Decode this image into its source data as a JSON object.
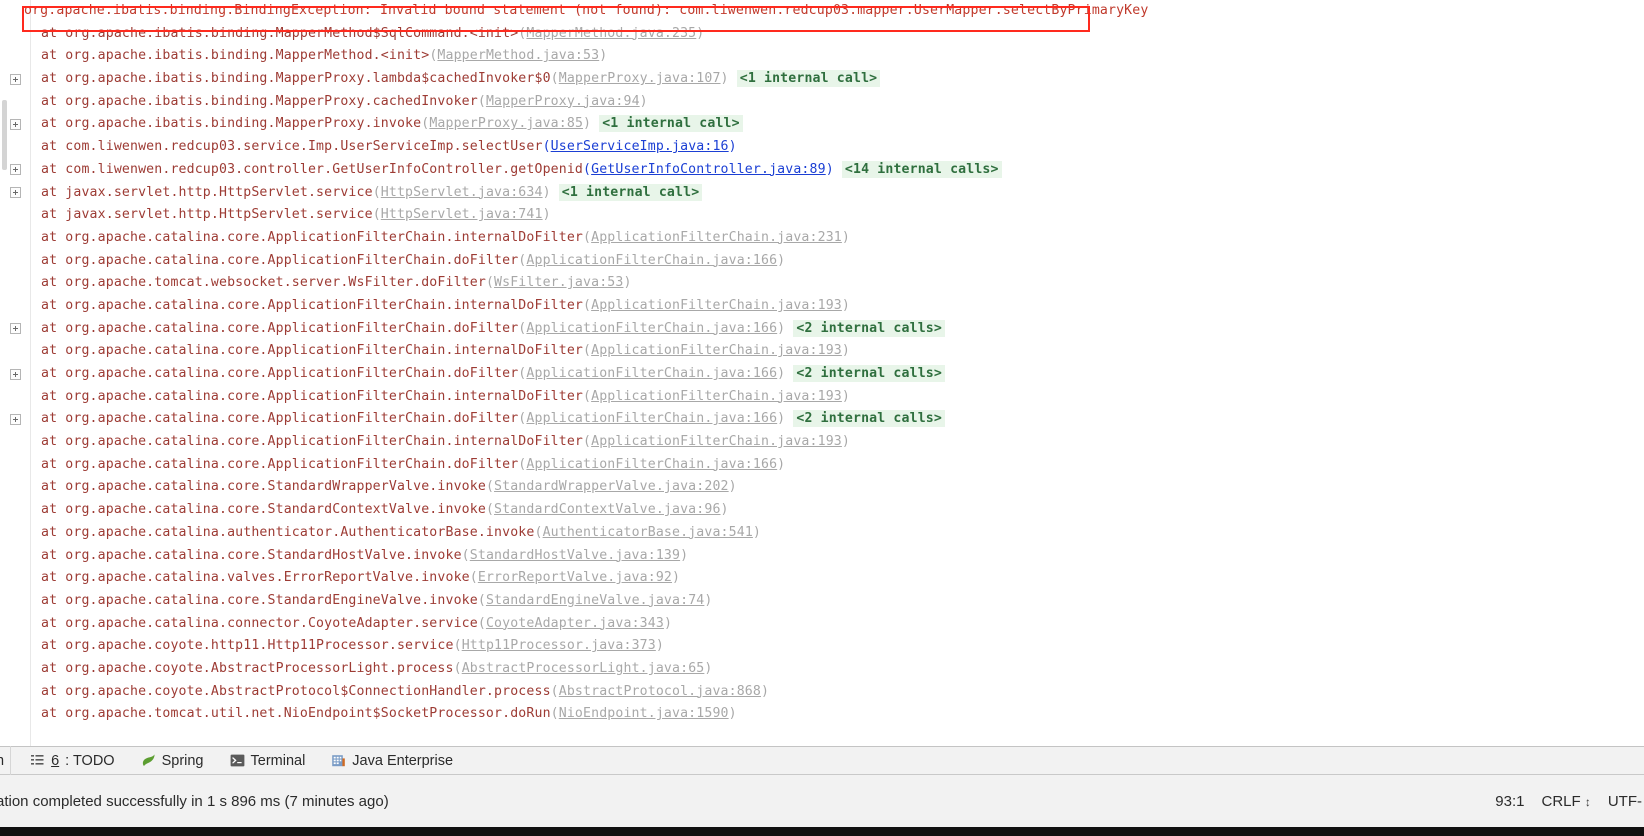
{
  "console": {
    "exception_header": "org.apache.ibatis.binding.BindingException: Invalid bound statement (not found): com.liwenwen.redcup03.mapper.UserMapper.selectByPrimaryKey",
    "frames": [
      {
        "fold": false,
        "at": "at ",
        "frame": "org.apache.ibatis.binding.MapperMethod$SqlCommand.<init>",
        "link": "MapperMethod.java:235",
        "link_type": "lib",
        "internal": ""
      },
      {
        "fold": false,
        "at": "at ",
        "frame": "org.apache.ibatis.binding.MapperMethod.<init>",
        "link": "MapperMethod.java:53",
        "link_type": "lib",
        "internal": ""
      },
      {
        "fold": true,
        "at": "at ",
        "frame": "org.apache.ibatis.binding.MapperProxy.lambda$cachedInvoker$0",
        "link": "MapperProxy.java:107",
        "link_type": "lib",
        "internal": "<1 internal call>"
      },
      {
        "fold": false,
        "at": "at ",
        "frame": "org.apache.ibatis.binding.MapperProxy.cachedInvoker",
        "link": "MapperProxy.java:94",
        "link_type": "lib",
        "internal": ""
      },
      {
        "fold": true,
        "at": "at ",
        "frame": "org.apache.ibatis.binding.MapperProxy.invoke",
        "link": "MapperProxy.java:85",
        "link_type": "lib",
        "internal": "<1 internal call>"
      },
      {
        "fold": false,
        "at": "at ",
        "frame": "com.liwenwen.redcup03.service.Imp.UserServiceImp.selectUser",
        "link": "UserServiceImp.java:16",
        "link_type": "user",
        "internal": ""
      },
      {
        "fold": true,
        "at": "at ",
        "frame": "com.liwenwen.redcup03.controller.GetUserInfoController.getOpenid",
        "link": "GetUserInfoController.java:89",
        "link_type": "user",
        "internal": "<14 internal calls>"
      },
      {
        "fold": true,
        "at": "at ",
        "frame": "javax.servlet.http.HttpServlet.service",
        "link": "HttpServlet.java:634",
        "link_type": "lib",
        "internal": "<1 internal call>"
      },
      {
        "fold": false,
        "at": "at ",
        "frame": "javax.servlet.http.HttpServlet.service",
        "link": "HttpServlet.java:741",
        "link_type": "lib",
        "internal": ""
      },
      {
        "fold": false,
        "at": "at ",
        "frame": "org.apache.catalina.core.ApplicationFilterChain.internalDoFilter",
        "link": "ApplicationFilterChain.java:231",
        "link_type": "lib",
        "internal": ""
      },
      {
        "fold": false,
        "at": "at ",
        "frame": "org.apache.catalina.core.ApplicationFilterChain.doFilter",
        "link": "ApplicationFilterChain.java:166",
        "link_type": "lib",
        "internal": ""
      },
      {
        "fold": false,
        "at": "at ",
        "frame": "org.apache.tomcat.websocket.server.WsFilter.doFilter",
        "link": "WsFilter.java:53",
        "link_type": "lib",
        "internal": ""
      },
      {
        "fold": false,
        "at": "at ",
        "frame": "org.apache.catalina.core.ApplicationFilterChain.internalDoFilter",
        "link": "ApplicationFilterChain.java:193",
        "link_type": "lib",
        "internal": ""
      },
      {
        "fold": true,
        "at": "at ",
        "frame": "org.apache.catalina.core.ApplicationFilterChain.doFilter",
        "link": "ApplicationFilterChain.java:166",
        "link_type": "lib",
        "internal": "<2 internal calls>"
      },
      {
        "fold": false,
        "at": "at ",
        "frame": "org.apache.catalina.core.ApplicationFilterChain.internalDoFilter",
        "link": "ApplicationFilterChain.java:193",
        "link_type": "lib",
        "internal": ""
      },
      {
        "fold": true,
        "at": "at ",
        "frame": "org.apache.catalina.core.ApplicationFilterChain.doFilter",
        "link": "ApplicationFilterChain.java:166",
        "link_type": "lib",
        "internal": "<2 internal calls>"
      },
      {
        "fold": false,
        "at": "at ",
        "frame": "org.apache.catalina.core.ApplicationFilterChain.internalDoFilter",
        "link": "ApplicationFilterChain.java:193",
        "link_type": "lib",
        "internal": ""
      },
      {
        "fold": true,
        "at": "at ",
        "frame": "org.apache.catalina.core.ApplicationFilterChain.doFilter",
        "link": "ApplicationFilterChain.java:166",
        "link_type": "lib",
        "internal": "<2 internal calls>"
      },
      {
        "fold": false,
        "at": "at ",
        "frame": "org.apache.catalina.core.ApplicationFilterChain.internalDoFilter",
        "link": "ApplicationFilterChain.java:193",
        "link_type": "lib",
        "internal": ""
      },
      {
        "fold": false,
        "at": "at ",
        "frame": "org.apache.catalina.core.ApplicationFilterChain.doFilter",
        "link": "ApplicationFilterChain.java:166",
        "link_type": "lib",
        "internal": ""
      },
      {
        "fold": false,
        "at": "at ",
        "frame": "org.apache.catalina.core.StandardWrapperValve.invoke",
        "link": "StandardWrapperValve.java:202",
        "link_type": "lib",
        "internal": ""
      },
      {
        "fold": false,
        "at": "at ",
        "frame": "org.apache.catalina.core.StandardContextValve.invoke",
        "link": "StandardContextValve.java:96",
        "link_type": "lib",
        "internal": ""
      },
      {
        "fold": false,
        "at": "at ",
        "frame": "org.apache.catalina.authenticator.AuthenticatorBase.invoke",
        "link": "AuthenticatorBase.java:541",
        "link_type": "lib",
        "internal": ""
      },
      {
        "fold": false,
        "at": "at ",
        "frame": "org.apache.catalina.core.StandardHostValve.invoke",
        "link": "StandardHostValve.java:139",
        "link_type": "lib",
        "internal": ""
      },
      {
        "fold": false,
        "at": "at ",
        "frame": "org.apache.catalina.valves.ErrorReportValve.invoke",
        "link": "ErrorReportValve.java:92",
        "link_type": "lib",
        "internal": ""
      },
      {
        "fold": false,
        "at": "at ",
        "frame": "org.apache.catalina.core.StandardEngineValve.invoke",
        "link": "StandardEngineValve.java:74",
        "link_type": "lib",
        "internal": ""
      },
      {
        "fold": false,
        "at": "at ",
        "frame": "org.apache.catalina.connector.CoyoteAdapter.service",
        "link": "CoyoteAdapter.java:343",
        "link_type": "lib",
        "internal": ""
      },
      {
        "fold": false,
        "at": "at ",
        "frame": "org.apache.coyote.http11.Http11Processor.service",
        "link": "Http11Processor.java:373",
        "link_type": "lib",
        "internal": ""
      },
      {
        "fold": false,
        "at": "at ",
        "frame": "org.apache.coyote.AbstractProcessorLight.process",
        "link": "AbstractProcessorLight.java:65",
        "link_type": "lib",
        "internal": ""
      },
      {
        "fold": false,
        "at": "at ",
        "frame": "org.apache.coyote.AbstractProtocol$ConnectionHandler.process",
        "link": "AbstractProtocol.java:868",
        "link_type": "lib",
        "internal": ""
      },
      {
        "fold": false,
        "at": "at ",
        "frame": "org.apache.tomcat.util.net.NioEndpoint$SocketProcessor.doRun",
        "link": "NioEndpoint.java:1590",
        "link_type": "lib",
        "internal": ""
      }
    ]
  },
  "toolwindow_bar": {
    "partial_label": "n",
    "items": [
      {
        "icon": "todo-icon",
        "number": "6",
        "label": ": TODO"
      },
      {
        "icon": "spring-leaf-icon",
        "number": "",
        "label": "Spring"
      },
      {
        "icon": "terminal-icon",
        "number": "",
        "label": "Terminal"
      },
      {
        "icon": "java-enterprise-icon",
        "number": "",
        "label": "Java Enterprise"
      }
    ]
  },
  "statusbar": {
    "message": "ation completed successfully in 1 s 896 ms (7 minutes ago)",
    "caret_position": "93:1",
    "line_separator": "CRLF",
    "encoding": "UTF-"
  },
  "colors": {
    "error_red": "#9d3b34",
    "box_red": "#ff2a1e",
    "user_link_blue": "#1b3fd4",
    "lib_link_gray": "#a8a8a8",
    "internal_green": "#2f6f3e",
    "internal_bg": "#e8f5e9"
  }
}
